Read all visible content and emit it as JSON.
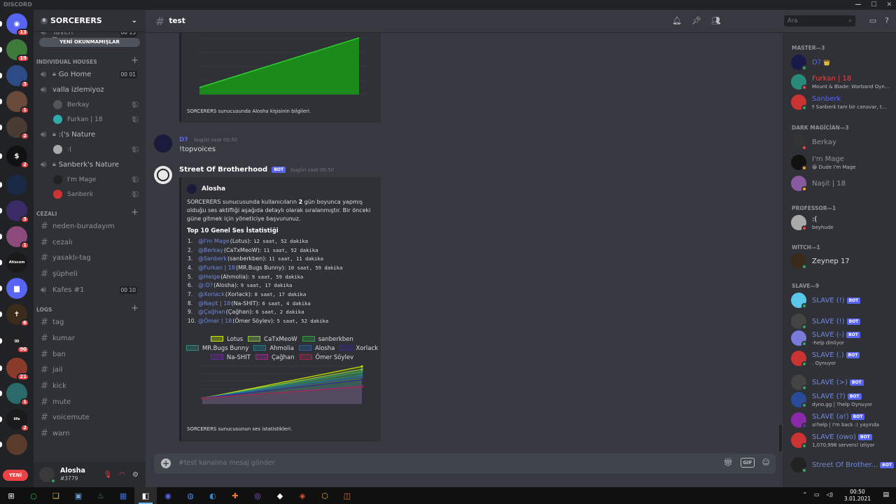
{
  "window": {
    "title": "DISCORD"
  },
  "server": {
    "name": "SORCERERS",
    "badge": "0",
    "unread_banner": "YENİ OKUNMAMIŞLAR"
  },
  "guilds": [
    {
      "color": "#5865f2",
      "glyph": "◉",
      "badge": "13"
    },
    {
      "color": "#3e7a3a",
      "glyph": "",
      "badge": "19"
    },
    {
      "color": "#2b4a86",
      "glyph": "",
      "badge": "3"
    },
    {
      "color": "#6a4a3a",
      "glyph": "",
      "badge": "1"
    },
    {
      "color": "#4a3b32",
      "glyph": "",
      "badge": "2"
    },
    {
      "color": "#111111",
      "glyph": "$",
      "badge": "2"
    },
    {
      "color": "#1b2a44",
      "glyph": "",
      "badge": ""
    },
    {
      "color": "#3a2a66",
      "glyph": "",
      "badge": "3"
    },
    {
      "color": "#8a4a7a",
      "glyph": "",
      "badge": "1"
    },
    {
      "color": "#1a1a1a",
      "glyph": "Atiscom",
      "badge": ""
    },
    {
      "color": "#5865f2",
      "glyph": "▆",
      "badge": ""
    },
    {
      "color": "#3a2b1a",
      "glyph": "✝",
      "badge": "6"
    },
    {
      "color": "#222222",
      "glyph": "∞",
      "badge": "90"
    },
    {
      "color": "#8a3a2a",
      "glyph": "",
      "badge": "21"
    },
    {
      "color": "#2a6a6a",
      "glyph": "",
      "badge": "1"
    },
    {
      "color": "#1a1a1a",
      "glyph": "life",
      "badge": "2"
    },
    {
      "color": "#5a3a2a",
      "glyph": "",
      "badge": ""
    }
  ],
  "channel_sidebar": {
    "partial_top": [
      {
        "name": "Taverr",
        "count": "00 15"
      },
      {
        "name": "Tower",
        "count": "00 15"
      }
    ],
    "cat_houses": "INDIVIDUAL HOUSES",
    "houses": [
      {
        "name": "Go Home",
        "count": "00 01",
        "members": []
      },
      {
        "name": "valla izlemiyoz",
        "count": "",
        "members": [
          {
            "name": "Berkay",
            "color": "#555"
          },
          {
            "name": "Furkan | 18",
            "color": "#3aa"
          }
        ]
      },
      {
        "name": ":('s Nature",
        "count": "",
        "members": [
          {
            "name": ":(",
            "color": "#aaa"
          }
        ]
      },
      {
        "name": "Sanberk's Nature",
        "count": "",
        "members": [
          {
            "name": "I'm Mage",
            "color": "#222"
          },
          {
            "name": "Sanberk",
            "color": "#c33"
          }
        ]
      }
    ],
    "cat_cezali": "CEZALI",
    "cezali": [
      {
        "name": "neden-buradayım",
        "count": ""
      },
      {
        "name": "cezalı",
        "count": ""
      },
      {
        "name": "yasaklı-tag",
        "count": ""
      },
      {
        "name": "şüpheli",
        "count": ""
      },
      {
        "name": "Kafes #1",
        "count": "00 10"
      }
    ],
    "cat_logs": "LOGS",
    "logs": [
      "tag",
      "kumar",
      "ban",
      "jail",
      "kick",
      "mute",
      "voicemute",
      "warn"
    ]
  },
  "user_panel": {
    "name": "Alosha",
    "tag": "#3779",
    "new_label": "YENİ"
  },
  "header": {
    "channel": "test",
    "search_placeholder": "Ara"
  },
  "messages": {
    "embed1_footer": "SORCERERS sunucusunda Alosha kişisinin bilgileri.",
    "msg2_author": "D?",
    "msg2_time": "bugün saat 00:50",
    "msg2_text": "!topvoices",
    "msg3_author": "Street Of Brotherhood",
    "msg3_bot": "BOT",
    "msg3_time": "bugün saat 00:50",
    "embed_author": "Alosha",
    "embed_desc_pre": "SORCERERS sunucusunda kullanıcıların ",
    "embed_desc_bold": "2",
    "embed_desc_post": " gün boyunca yapmış olduğu ses aktifliği aşağıda detaylı olarak sıralanmıştır. Bir önceki güne gitmek için yöneticiye başvurunuz.",
    "embed_field_title": "Top 10 Genel Ses İstatistiği",
    "ranking": [
      {
        "n": "1.",
        "mention": "@I'm Mage",
        "alias": "(Lotus):",
        "time": "12 saat,  52 dakika"
      },
      {
        "n": "2.",
        "mention": "@Berkay",
        "alias": "(CaTxMeoW):",
        "time": "11 saat,  52 dakika"
      },
      {
        "n": "3.",
        "mention": "@Sanberk",
        "alias": "(sanberkben):",
        "time": "11 saat,  11 dakika"
      },
      {
        "n": "4.",
        "mention": "@Furkan | 18",
        "alias": "(MR.Bugs Bunny):",
        "time": "10 saat,  59 dakika"
      },
      {
        "n": "5.",
        "mention": "@Helge",
        "alias": "(Ahmolia):",
        "time": "9 saat,  59 dakika"
      },
      {
        "n": "6.",
        "mention": "@:D?",
        "alias": "(Alosha):",
        "time": "9 saat,  17 dakika"
      },
      {
        "n": "7.",
        "mention": "@Xorlack",
        "alias": "(Xorlack):",
        "time": "8 saat,  17 dakika"
      },
      {
        "n": "8.",
        "mention": "@Naşit | 18",
        "alias": "(Na-SHIT):",
        "time": "6 saat,  4 dakika"
      },
      {
        "n": "9.",
        "mention": "@Çağhan",
        "alias": "(Çağhan):",
        "time": "6 saat,  2 dakika"
      },
      {
        "n": "10.",
        "mention": "@Ömer | 18",
        "alias": "(Ömer Söylev):",
        "time": "5 saat,  52 dakika"
      }
    ],
    "legend": [
      {
        "name": "Lotus",
        "color": "#c8e600"
      },
      {
        "name": "CaTxMeoW",
        "color": "#8bc34a"
      },
      {
        "name": "sanberkben",
        "color": "#2e9e3e"
      },
      {
        "name": "MR.Bugs Bunny",
        "color": "#2e8b7a"
      },
      {
        "name": "Ahmolia",
        "color": "#1f7c8a"
      },
      {
        "name": "Alosha",
        "color": "#2a5aa0"
      },
      {
        "name": "Xorlack",
        "color": "#3a2a8a"
      },
      {
        "name": "Na-SHIT",
        "color": "#6a2a9a"
      },
      {
        "name": "Çağhan",
        "color": "#9a2a8a"
      },
      {
        "name": "Ömer Söylev",
        "color": "#9a2a4a"
      }
    ],
    "embed2_footer": "SORCERERS sunucusunun ses istatistikleri.",
    "input_placeholder": "#test kanalına mesaj gönder"
  },
  "members": {
    "groups": [
      {
        "label": "MASTER—3",
        "items": [
          {
            "name": "D?",
            "status": "",
            "color": "#5865f2",
            "av": "#1a1a4a",
            "dot": "#3ba55d",
            "tag": "👑"
          },
          {
            "name": "Furkan | 18",
            "status": "Mount & Blade: Warband Oyn...",
            "color": "#ed4245",
            "av": "#2a8a7a",
            "dot": "#ed4245"
          },
          {
            "name": "Sanberk",
            "status": "‼ Sanberk tam bir canavar, t...",
            "color": "#5865f2",
            "av": "#c33",
            "dot": "#3ba55d"
          }
        ]
      },
      {
        "label": "DARK MAGİCİAN—3",
        "items": [
          {
            "name": "Berkay",
            "status": "",
            "color": "#8e9297",
            "av": "#333",
            "dot": "#ed4245"
          },
          {
            "name": "I'm Mage",
            "status": "😀 Dude I'm Mage",
            "color": "#8e9297",
            "av": "#111",
            "dot": "#faa61a"
          },
          {
            "name": "Naşit | 18",
            "status": "",
            "color": "#8e9297",
            "av": "#8a5aa0",
            "dot": "#faa61a"
          }
        ]
      },
      {
        "label": "PROFESSOR—1",
        "items": [
          {
            "name": ":(",
            "status": "beyhude",
            "color": "#ffffff",
            "av": "#aaa",
            "dot": "#ed4245"
          }
        ]
      },
      {
        "label": "WİTCH—1",
        "items": [
          {
            "name": "Zeynep 17",
            "status": "",
            "color": "#dcddde",
            "av": "#3a2a1a",
            "dot": "#3ba55d"
          }
        ]
      },
      {
        "label": "SLAVE—9",
        "items": [
          {
            "name": "SLAVE (!)",
            "status": "",
            "color": "#7289da",
            "av": "#5ac8e8",
            "dot": "#3ba55d",
            "bot": "BOT"
          },
          {
            "name": "SLAVE (!)",
            "status": "",
            "color": "#7289da",
            "av": "#444",
            "dot": "#3ba55d",
            "bot": "BOT"
          },
          {
            "name": "SLAVE (-)",
            "status": "-help dinliyor",
            "color": "#7289da",
            "av": "#7a7ad8",
            "dot": "#3ba55d",
            "bot": "BOT"
          },
          {
            "name": "SLAVE (.)",
            "status": ". Oynuyor",
            "color": "#7289da",
            "av": "#c33",
            "dot": "#3ba55d",
            "bot": "BOT"
          },
          {
            "name": "SLAVE (>)",
            "status": "",
            "color": "#7289da",
            "av": "#444",
            "dot": "#3ba55d",
            "bot": "BOT"
          },
          {
            "name": "SLAVE (?)",
            "status": "dyno.gg | ?help Oynuyor",
            "color": "#7289da",
            "av": "#2a4a9a",
            "dot": "#3ba55d",
            "bot": "BOT"
          },
          {
            "name": "SLAVE (a!)",
            "status": "a!help | I'm back :) yayında",
            "color": "#7289da",
            "av": "#8a2aaa",
            "dot": "#593695",
            "bot": "BOT"
          },
          {
            "name": "SLAVE (owo)",
            "status": "1,070,996 servers! izliyor",
            "color": "#7289da",
            "av": "#c33",
            "dot": "#3ba55d",
            "bot": "BOT"
          },
          {
            "name": "Street Of Brother...",
            "status": "",
            "color": "#7289da",
            "av": "#222",
            "dot": "#3ba55d",
            "bot": "BOT"
          }
        ]
      }
    ]
  },
  "taskbar": {
    "time": "00:50",
    "date": "3.01.2021",
    "apps": [
      "⊞",
      "○",
      "❑",
      "▣",
      "♨",
      "▦",
      "◧",
      "◉",
      "◍",
      "◐",
      "✚",
      "◎",
      "◆",
      "◈",
      "⬡",
      "◫"
    ]
  }
}
